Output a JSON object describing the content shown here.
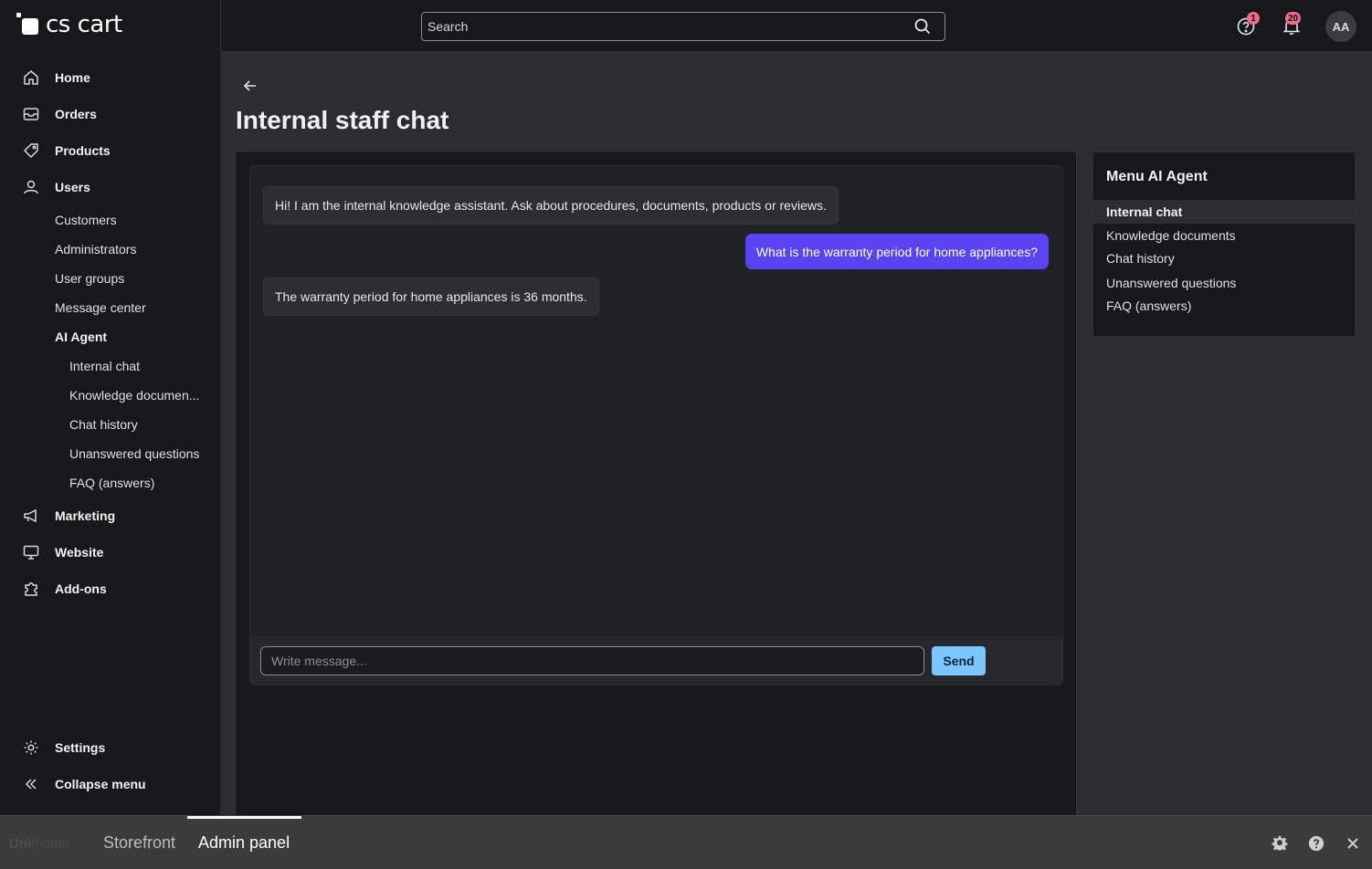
{
  "brand": {
    "logo_text": "cs cart"
  },
  "sidebar": {
    "main_items": [
      {
        "label": "Home",
        "icon": "home-icon"
      },
      {
        "label": "Orders",
        "icon": "inbox-icon"
      },
      {
        "label": "Products",
        "icon": "tag-icon"
      },
      {
        "label": "Users",
        "icon": "user-icon"
      }
    ],
    "users_sub": [
      "Customers",
      "Administrators",
      "User groups",
      "Message center"
    ],
    "ai_agent": "AI Agent",
    "ai_agent_sub": [
      "Internal chat",
      "Knowledge documen...",
      "Chat history",
      "Unanswered questions",
      "FAQ (answers)"
    ],
    "more_items": [
      {
        "label": "Marketing",
        "icon": "megaphone-icon"
      },
      {
        "label": "Website",
        "icon": "monitor-icon"
      },
      {
        "label": "Add-ons",
        "icon": "puzzle-icon"
      }
    ],
    "settings": "Settings",
    "collapse": "Collapse menu"
  },
  "topbar": {
    "search_placeholder": "Search",
    "help_badge": "1",
    "notifications_badge": "20",
    "avatar_initials": "AA"
  },
  "main": {
    "title": "Internal staff chat",
    "messages": [
      {
        "role": "bot",
        "text": "Hi! I am the internal knowledge assistant. Ask about procedures, documents, products or reviews."
      },
      {
        "role": "user",
        "text": "What is the warranty period for home appliances?"
      },
      {
        "role": "bot",
        "text": "The warranty period for home appliances is 36 months."
      }
    ],
    "input_placeholder": "Write message...",
    "send_label": "Send"
  },
  "side_menu": {
    "title": "Menu AI Agent",
    "items": [
      "Internal chat",
      "Knowledge documents",
      "Chat history",
      "Unanswered questions",
      "FAQ (answers)"
    ],
    "active": "Internal chat"
  },
  "bottombar": {
    "logo_bold": "Uni",
    "logo_rest": "theme",
    "tabs": [
      "Storefront",
      "Admin panel"
    ],
    "active_tab": "Admin panel"
  },
  "colors": {
    "accent": "#5a43f0",
    "send_button": "#7cc5ff",
    "badge": "#f06a8a",
    "background": "#2b2d30",
    "panel": "#17181a"
  }
}
